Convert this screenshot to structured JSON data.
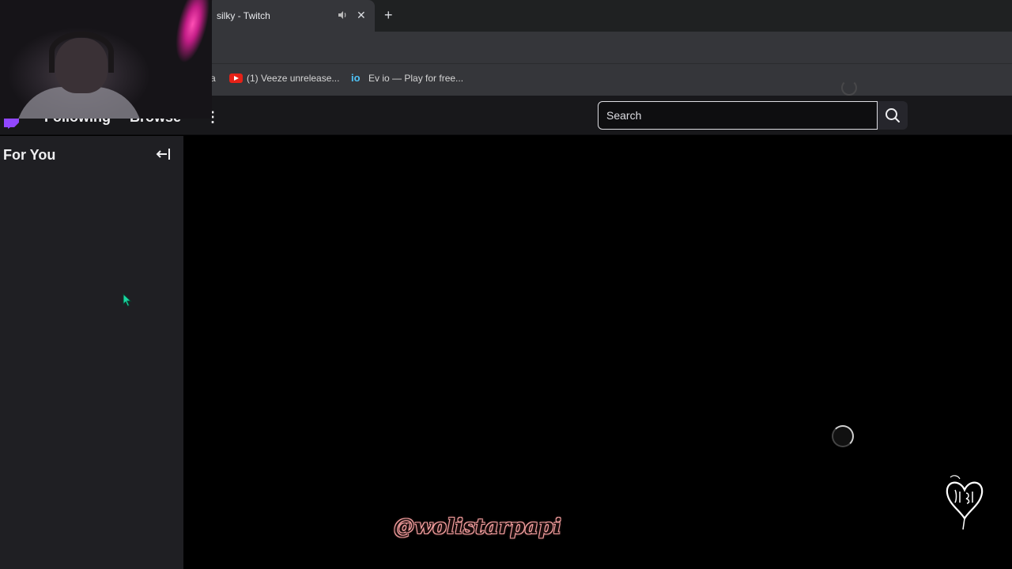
{
  "browser": {
    "tab_title": "silky - Twitch",
    "tab_close": "✕",
    "new_tab": "+",
    "bookmarks": [
      {
        "label": "a"
      },
      {
        "label": "(1) Veeze unrelease...",
        "icon": "youtube-icon"
      },
      {
        "label": "Ev io — Play for free...",
        "icon": "io-icon",
        "icon_text": "io"
      }
    ]
  },
  "nav": {
    "search_placeholder": "Search",
    "links": [
      "Following",
      "Browse"
    ]
  },
  "sidebar": {
    "title": "For You",
    "collapse_icon": "collapse-left-icon"
  },
  "overlay": {
    "watermark": "@wolistarpapi"
  },
  "colors": {
    "twitch_purple": "#9147ff",
    "nav_bg": "#18181b",
    "sidebar_bg": "#1f1f23",
    "main_bg": "#000000"
  }
}
